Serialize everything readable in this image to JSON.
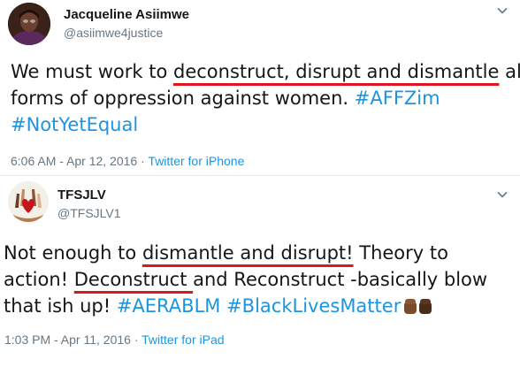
{
  "tweets": [
    {
      "author": {
        "name": "Jacqueline Asiimwe",
        "handle": "@asiimwe4justice",
        "avatar": "profile-photo-avatar"
      },
      "text_lines": [
        [
          {
            "t": "We must work to ",
            "k": "plain"
          },
          {
            "t": "deconstruct, disrupt and dismantle",
            "k": "underlined"
          },
          {
            "t": " all",
            "k": "plain"
          }
        ],
        [
          {
            "t": "forms of oppression against women. ",
            "k": "plain"
          },
          {
            "t": "#AFFZim",
            "k": "hashtag"
          }
        ],
        [
          {
            "t": "#NotYetEqual",
            "k": "hashtag"
          }
        ]
      ],
      "time": "6:06 AM - Apr 12, 2016",
      "separator": " · ",
      "source": "Twitter for iPhone"
    },
    {
      "author": {
        "name": "TFSJLV",
        "handle": "@TFSJLV1",
        "avatar": "raised-hands-heart-avatar"
      },
      "text_lines": [
        [
          {
            "t": "Not enough to ",
            "k": "plain"
          },
          {
            "t": "dismantle and disrupt!",
            "k": "underlined"
          },
          {
            "t": "  Theory to",
            "k": "plain"
          }
        ],
        [
          {
            "t": "action!  ",
            "k": "plain"
          },
          {
            "t": "Deconstruct ",
            "k": "underlined"
          },
          {
            "t": "and Reconstruct -basically blow",
            "k": "plain"
          }
        ],
        [
          {
            "t": "that ish up! ",
            "k": "plain"
          },
          {
            "t": "#AERABLM",
            "k": "hashtag"
          },
          {
            "t": " ",
            "k": "plain"
          },
          {
            "t": "#BlackLivesMatter",
            "k": "hashtag"
          }
        ]
      ],
      "emoji": "raised-fist-emoji-pair",
      "time": "1:03 PM - Apr 11, 2016",
      "separator": " · ",
      "source": "Twitter for iPad"
    }
  ],
  "colors": {
    "link": "#1b95e0",
    "muted": "#657786",
    "text": "#14171a",
    "underline_marker": "#e0161e"
  }
}
